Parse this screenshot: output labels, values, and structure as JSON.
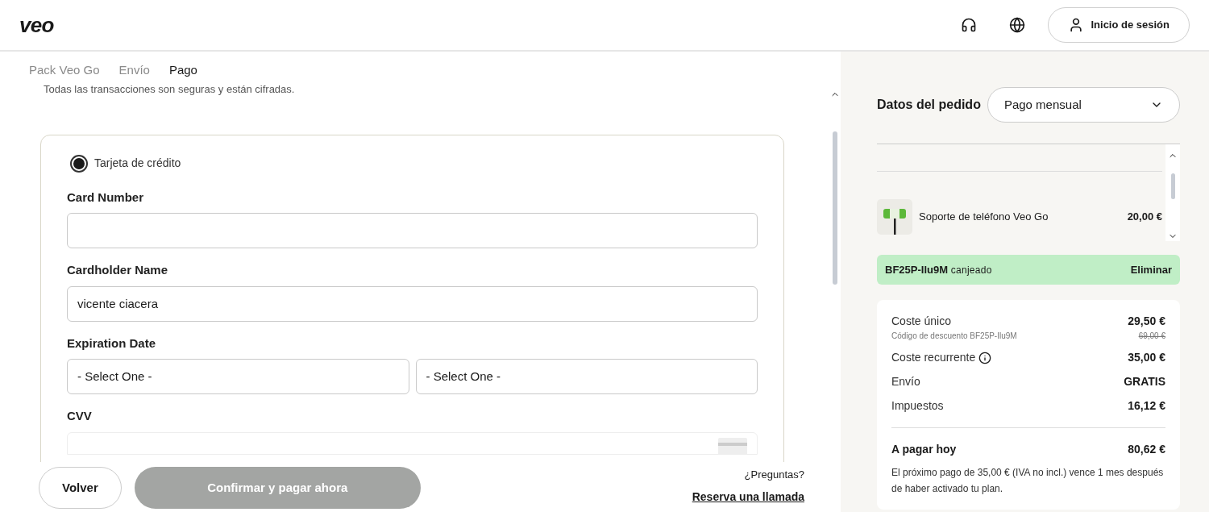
{
  "header": {
    "logo": "veo",
    "login_button": "Inicio de sesión"
  },
  "steps": [
    {
      "label": "Pack Veo Go",
      "selected": false
    },
    {
      "label": "Envío",
      "selected": false
    },
    {
      "label": "Pago",
      "selected": true
    }
  ],
  "security_note": "Todas las transacciones son seguras y están cifradas.",
  "payment_methods": [
    {
      "label": "Tarjeta de crédito",
      "selected": true
    }
  ],
  "fields": [
    {
      "kind": "text",
      "label": "Card Number"
    },
    {
      "kind": "text",
      "label": "Cardholder Name",
      "value": "vicente ciacera"
    },
    {
      "kind": "selects",
      "label": "Expiration Date",
      "options": [
        "- Select One -",
        "- Select One -"
      ]
    },
    {
      "kind": "cvv",
      "label": "CVV"
    }
  ],
  "footer": {
    "back_button": "Volver",
    "confirm_button": {
      "label": "Confirmar y pagar ahora",
      "disabled": true
    },
    "question": "¿Preguntas?",
    "call_link": "Reserva una llamada"
  },
  "order": {
    "title": "Datos del pedido",
    "plan_select": "Pago mensual",
    "items": [
      {
        "name": "Soporte de teléfono Veo Go",
        "price": "20,00 €"
      }
    ],
    "promo": {
      "code": "BF25P-Ilu9M",
      "status": "canjeado",
      "remove": "Eliminar"
    },
    "summary": [
      {
        "label": "Coste único",
        "value": "29,50 €",
        "sub_label": "Código de descuento BF25P-Ilu9M",
        "old_value": "69,00 €"
      },
      {
        "label": "Coste recurrente",
        "value": "35,00 €",
        "info": true
      },
      {
        "label": "Envío",
        "value": "GRATIS"
      },
      {
        "label": "Impuestos",
        "value": "16,12 €"
      }
    ],
    "total": {
      "label": "A pagar hoy",
      "value": "80,62 €"
    },
    "note": "El próximo pago de 35,00 € (IVA no incl.) vence 1 mes después de haber activado tu plan."
  }
}
